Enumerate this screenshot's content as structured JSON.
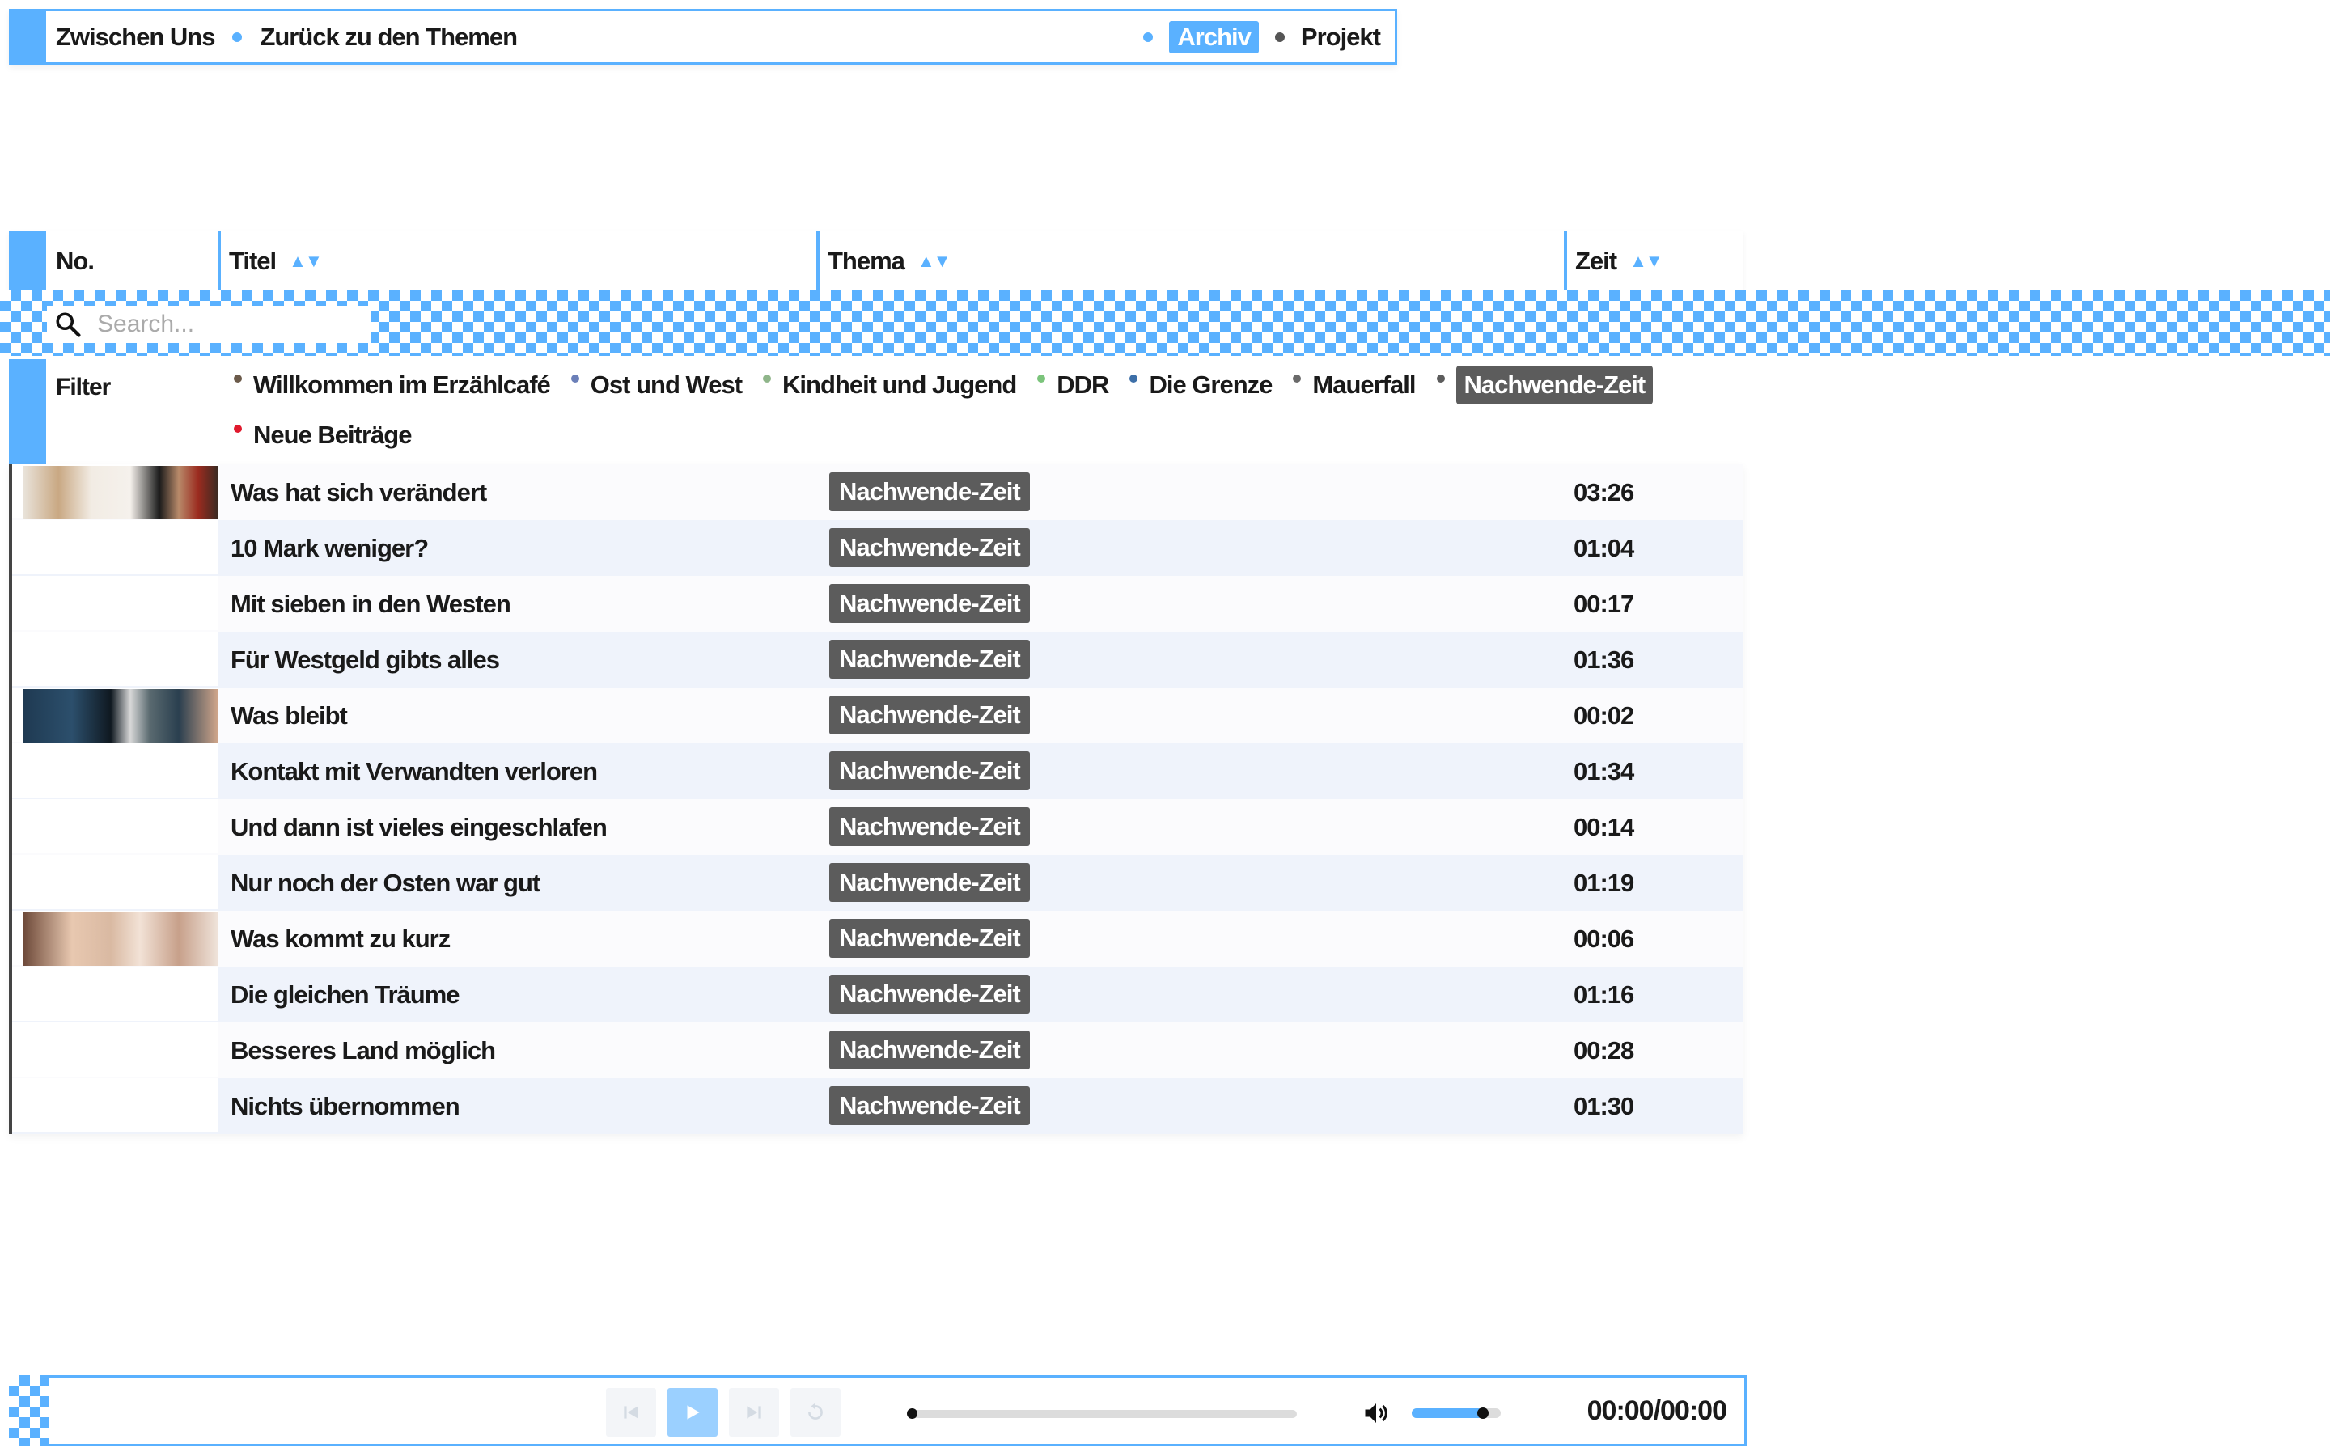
{
  "nav": {
    "brand": "Zwischen Uns",
    "back_link": "Zurück zu den Themen",
    "archive": "Archiv",
    "project": "Projekt"
  },
  "table": {
    "columns": {
      "no": "No.",
      "title": "Titel",
      "theme": "Thema",
      "time": "Zeit"
    },
    "sort_indicator": "▲▼",
    "search_placeholder": "Search...",
    "filter_label": "Filter",
    "filters": [
      {
        "label": "Willkommen im Erzählcafé",
        "color": "#6b5a4a",
        "active": false
      },
      {
        "label": "Ost und West",
        "color": "#6b7fb8",
        "active": false
      },
      {
        "label": "Kindheit und Jugend",
        "color": "#8fb58a",
        "active": false
      },
      {
        "label": "DDR",
        "color": "#7bc47b",
        "active": false
      },
      {
        "label": "Die Grenze",
        "color": "#3d6fa8",
        "active": false
      },
      {
        "label": "Mauerfall",
        "color": "#6a6a6a",
        "active": false
      },
      {
        "label": "Nachwende-Zeit",
        "color": "#5c5c5c",
        "active": true
      },
      {
        "label": "Neue Beiträge",
        "color": "#e0192d",
        "active": false
      }
    ],
    "rows": [
      {
        "thumb": "t1",
        "title": "Was hat sich verändert",
        "theme": "Nachwende-Zeit",
        "time": "03:26"
      },
      {
        "thumb": "",
        "title": "10 Mark weniger?",
        "theme": "Nachwende-Zeit",
        "time": "01:04"
      },
      {
        "thumb": "",
        "title": "Mit sieben in den Westen",
        "theme": "Nachwende-Zeit",
        "time": "00:17"
      },
      {
        "thumb": "",
        "title": "Für Westgeld gibts alles",
        "theme": "Nachwende-Zeit",
        "time": "01:36"
      },
      {
        "thumb": "t2",
        "title": "Was bleibt",
        "theme": "Nachwende-Zeit",
        "time": "00:02"
      },
      {
        "thumb": "",
        "title": "Kontakt mit Verwandten verloren",
        "theme": "Nachwende-Zeit",
        "time": "01:34"
      },
      {
        "thumb": "",
        "title": "Und dann ist vieles eingeschlafen",
        "theme": "Nachwende-Zeit",
        "time": "00:14"
      },
      {
        "thumb": "",
        "title": "Nur noch der Osten war gut",
        "theme": "Nachwende-Zeit",
        "time": "01:19"
      },
      {
        "thumb": "t3",
        "title": "Was kommt zu kurz",
        "theme": "Nachwende-Zeit",
        "time": "00:06"
      },
      {
        "thumb": "",
        "title": "Die gleichen Träume",
        "theme": "Nachwende-Zeit",
        "time": "01:16"
      },
      {
        "thumb": "",
        "title": "Besseres Land möglich",
        "theme": "Nachwende-Zeit",
        "time": "00:28"
      },
      {
        "thumb": "",
        "title": "Nichts übernommen",
        "theme": "Nachwende-Zeit",
        "time": "01:30"
      }
    ]
  },
  "player": {
    "time": "00:00/00:00",
    "progress": 0,
    "volume": 0.8,
    "icons": [
      "skip-back-icon",
      "play-icon",
      "skip-forward-icon",
      "replay-icon",
      "volume-icon"
    ]
  },
  "colors": {
    "accent": "#5ab1ff",
    "tag_bg": "#5c5c5c",
    "row_alt": "#eff3fb"
  }
}
